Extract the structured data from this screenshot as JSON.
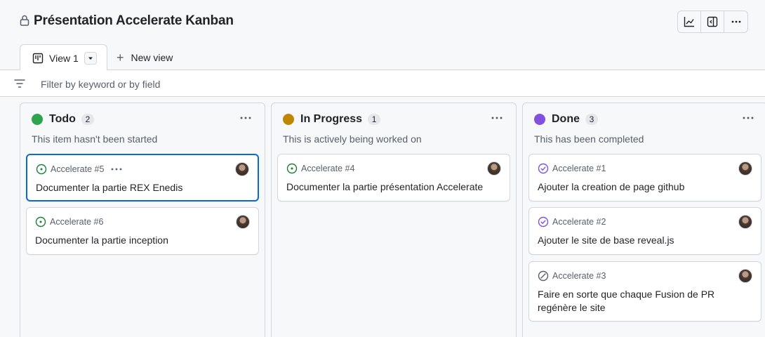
{
  "header": {
    "title": "Présentation Accelerate Kanban"
  },
  "tabs": {
    "active_label": "View 1",
    "new_view_label": "New view"
  },
  "filter": {
    "placeholder": "Filter by keyword or by field"
  },
  "columns": [
    {
      "name": "Todo",
      "count": "2",
      "description": "This item hasn't been started",
      "color": "#2da44e",
      "cards": [
        {
          "ref": "Accelerate #5",
          "title": "Documenter la partie REX Enedis",
          "status": "open",
          "selected": true
        },
        {
          "ref": "Accelerate #6",
          "title": "Documenter la partie inception",
          "status": "open"
        }
      ]
    },
    {
      "name": "In Progress",
      "count": "1",
      "description": "This is actively being worked on",
      "color": "#bf8700",
      "cards": [
        {
          "ref": "Accelerate #4",
          "title": "Documenter la partie présentation Accelerate",
          "status": "open"
        }
      ]
    },
    {
      "name": "Done",
      "count": "3",
      "description": "This has been completed",
      "color": "#8250df",
      "cards": [
        {
          "ref": "Accelerate #1",
          "title": "Ajouter la creation de page github",
          "status": "closed"
        },
        {
          "ref": "Accelerate #2",
          "title": "Ajouter le site de base reveal.js",
          "status": "closed"
        },
        {
          "ref": "Accelerate #3",
          "title": "Faire en sorte que chaque Fusion de PR regénère le site",
          "status": "not-planned"
        }
      ]
    }
  ],
  "colors": {
    "open": "#1a7f37",
    "closed": "#8250df",
    "not_planned": "#57606a",
    "accent": "#0969da"
  },
  "icons": {
    "lock": "lock-icon",
    "insights": "graph-icon",
    "sidepanel": "sidebar-icon",
    "more": "kebab-horizontal-icon",
    "board": "project-board-icon",
    "filter": "filter-icon"
  }
}
